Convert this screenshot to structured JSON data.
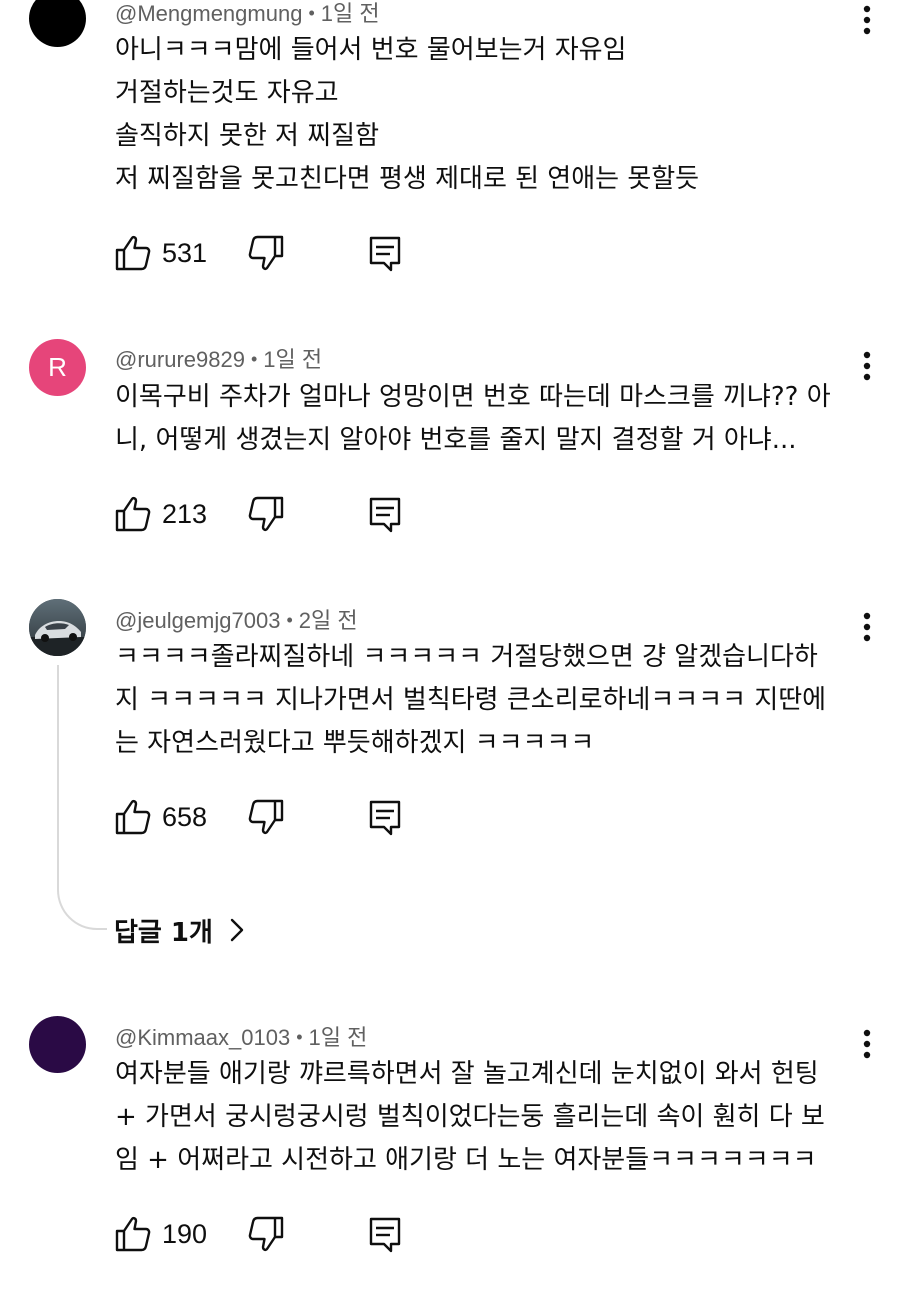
{
  "colors": {
    "avatar_1": "#000000",
    "avatar_2": "#e6457a",
    "avatar_4": "#2a0a45",
    "meta_text": "#606060",
    "thread_line": "#d9d9d9"
  },
  "comments": [
    {
      "author": "@Mengmengmung",
      "time": "1일 전",
      "avatar_letter": "",
      "text": "아니ㅋㅋㅋ맘에 들어서 번호 물어보는거 자유임\n거절하는것도 자유고\n솔직하지 못한 저 찌질함\n저 찌질함을 못고친다면 평생 제대로 된 연애는 못할듯",
      "likes": "531"
    },
    {
      "author": "@rurure9829",
      "time": "1일 전",
      "avatar_letter": "R",
      "text": "이목구비 주차가 얼마나 엉망이면 번호 따는데 마스크를 끼냐?? 아\n니, 어떻게 생겼는지 알아야 번호를 줄지 말지 결정할 거 아냐...",
      "likes": "213"
    },
    {
      "author": "@jeulgemjg7003",
      "time": "2일 전",
      "avatar_letter": "",
      "text": "ㅋㅋㅋㅋ졸라찌질하네 ㅋㅋㅋㅋㅋ 거절당했으면 걍 알겠습니다하\n지 ㅋㅋㅋㅋㅋ 지나가면서 벌칙타령 큰소리로하네ㅋㅋㅋㅋ 지딴에\n는 자연스러웠다고 뿌듯해하겠지 ㅋㅋㅋㅋㅋ",
      "likes": "658",
      "replies_label": "답글 1개"
    },
    {
      "author": "@Kimmaax_0103",
      "time": "1일 전",
      "avatar_letter": "",
      "text": "여자분들 애기랑 꺄르륵하면서 잘 놀고계신데 눈치없이 와서 헌팅\n+ 가면서 궁시렁궁시렁 벌칙이었다는둥 흘리는데 속이 훤히 다 보\n임 + 어쩌라고 시전하고 애기랑 더 노는 여자분들ㅋㅋㅋㅋㅋㅋㅋ",
      "likes": "190"
    }
  ],
  "icons": {
    "like": "thumbs-up-icon",
    "dislike": "thumbs-down-icon",
    "reply": "reply-comment-icon",
    "more": "more-vert-icon",
    "chevron": "chevron-right-icon"
  }
}
